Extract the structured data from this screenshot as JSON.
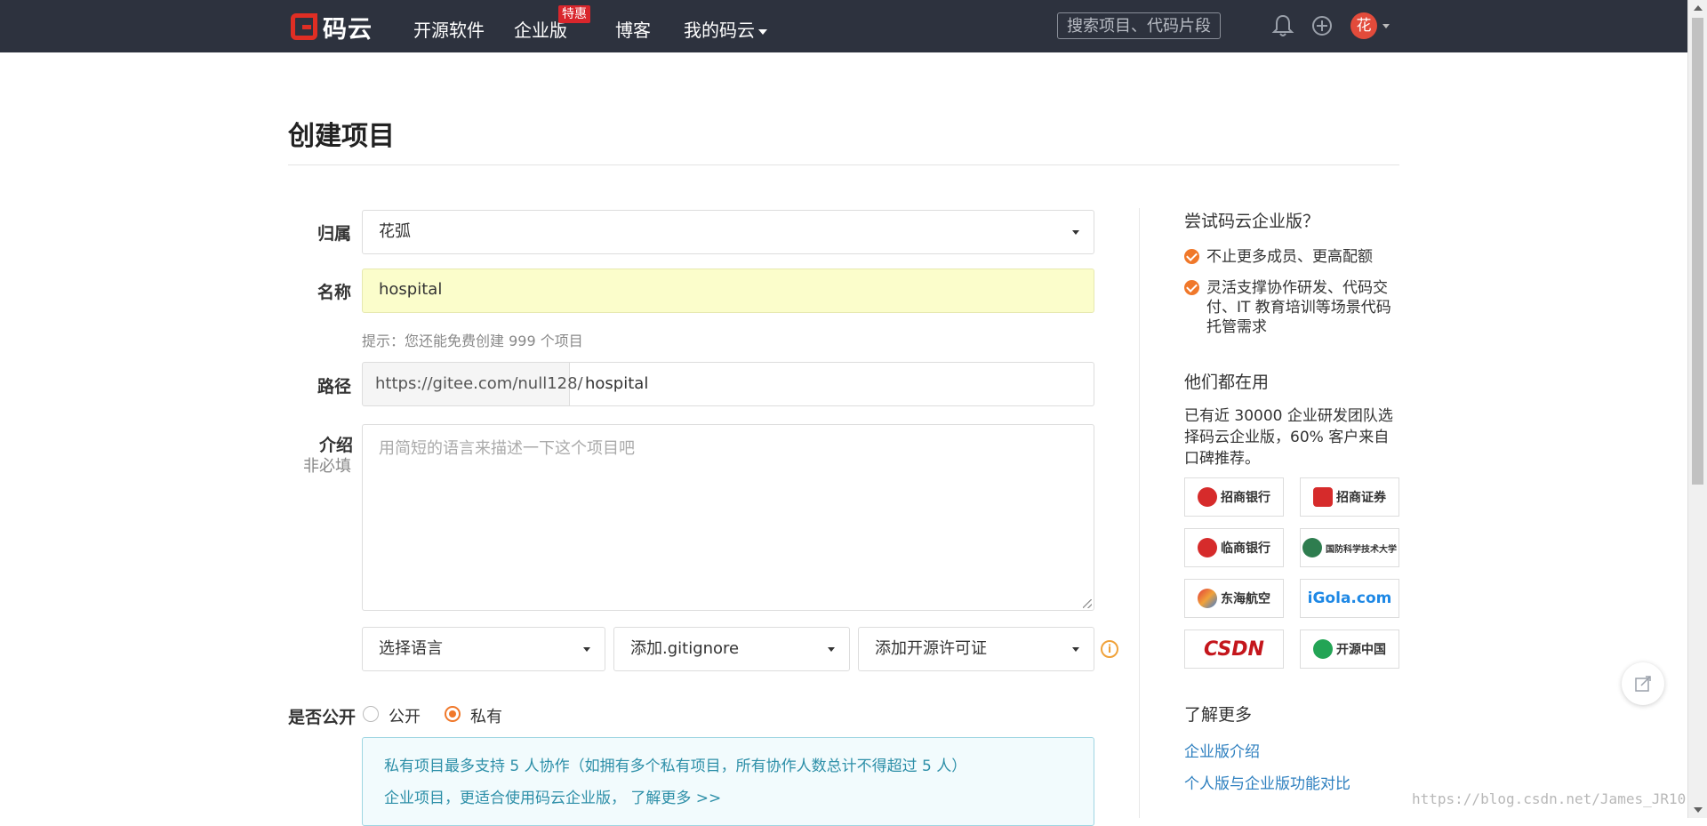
{
  "navbar": {
    "brand": "码云",
    "items": [
      "开源软件",
      "企业版",
      "博客",
      "我的码云"
    ],
    "enterprise_badge": "特惠",
    "search_placeholder": "搜索项目、代码片段...",
    "avatar_text": "花"
  },
  "page": {
    "title": "创建项目"
  },
  "form": {
    "owner_label": "归属",
    "owner_value": "花弧",
    "name_label": "名称",
    "name_value": "hospital",
    "hint": "提示：您还能免费创建 999 个项目",
    "path_label": "路径",
    "path_prefix": "https://gitee.com/null128/",
    "path_value": "hospital",
    "desc_label": "介绍",
    "desc_optional": "非必填",
    "desc_placeholder": "用简短的语言来描述一下这个项目吧",
    "language_select": "选择语言",
    "gitignore_select": "添加.gitignore",
    "license_select": "添加开源许可证",
    "visibility_label": "是否公开",
    "visibility_options": [
      "公开",
      "私有"
    ],
    "visibility_selected": "私有",
    "notice_line1": "私有项目最多支持 5 人协作（如拥有多个私有项目，所有协作人数总计不得超过 5 人）",
    "notice_line2": "企业项目，更适合使用码云企业版， 了解更多 >>"
  },
  "sidebar": {
    "try_title": "尝试码云企业版？",
    "benefits": [
      "不止更多成员、更高配额",
      "灵活支撑协作研发、代码交付、IT 教育培训等场景代码托管需求"
    ],
    "users_title": "他们都在用",
    "users_text": "已有近 30000 企业研发团队选择码云企业版，60% 客户来自口碑推荐。",
    "logos": [
      "招商银行",
      "招商证券",
      "临商银行",
      "国防科学技术大学",
      "东海航空",
      "iGola.com",
      "CSDN",
      "开源中国"
    ],
    "more_title": "了解更多",
    "links": [
      "企业版介绍",
      "个人版与企业版功能对比"
    ]
  },
  "watermark": "https://blog.csdn.net/James_JR10",
  "colors": {
    "navbar_bg": "#2d323e",
    "brand_red": "#e02e24",
    "accent_orange": "#f0782a",
    "name_input_bg": "#fbfdcb",
    "notice_text": "#2d8fa8",
    "link_blue": "#2d7fbf"
  },
  "icons": [
    "bell-icon",
    "plus-circle-icon",
    "info-icon",
    "check-icon",
    "share-icon"
  ]
}
